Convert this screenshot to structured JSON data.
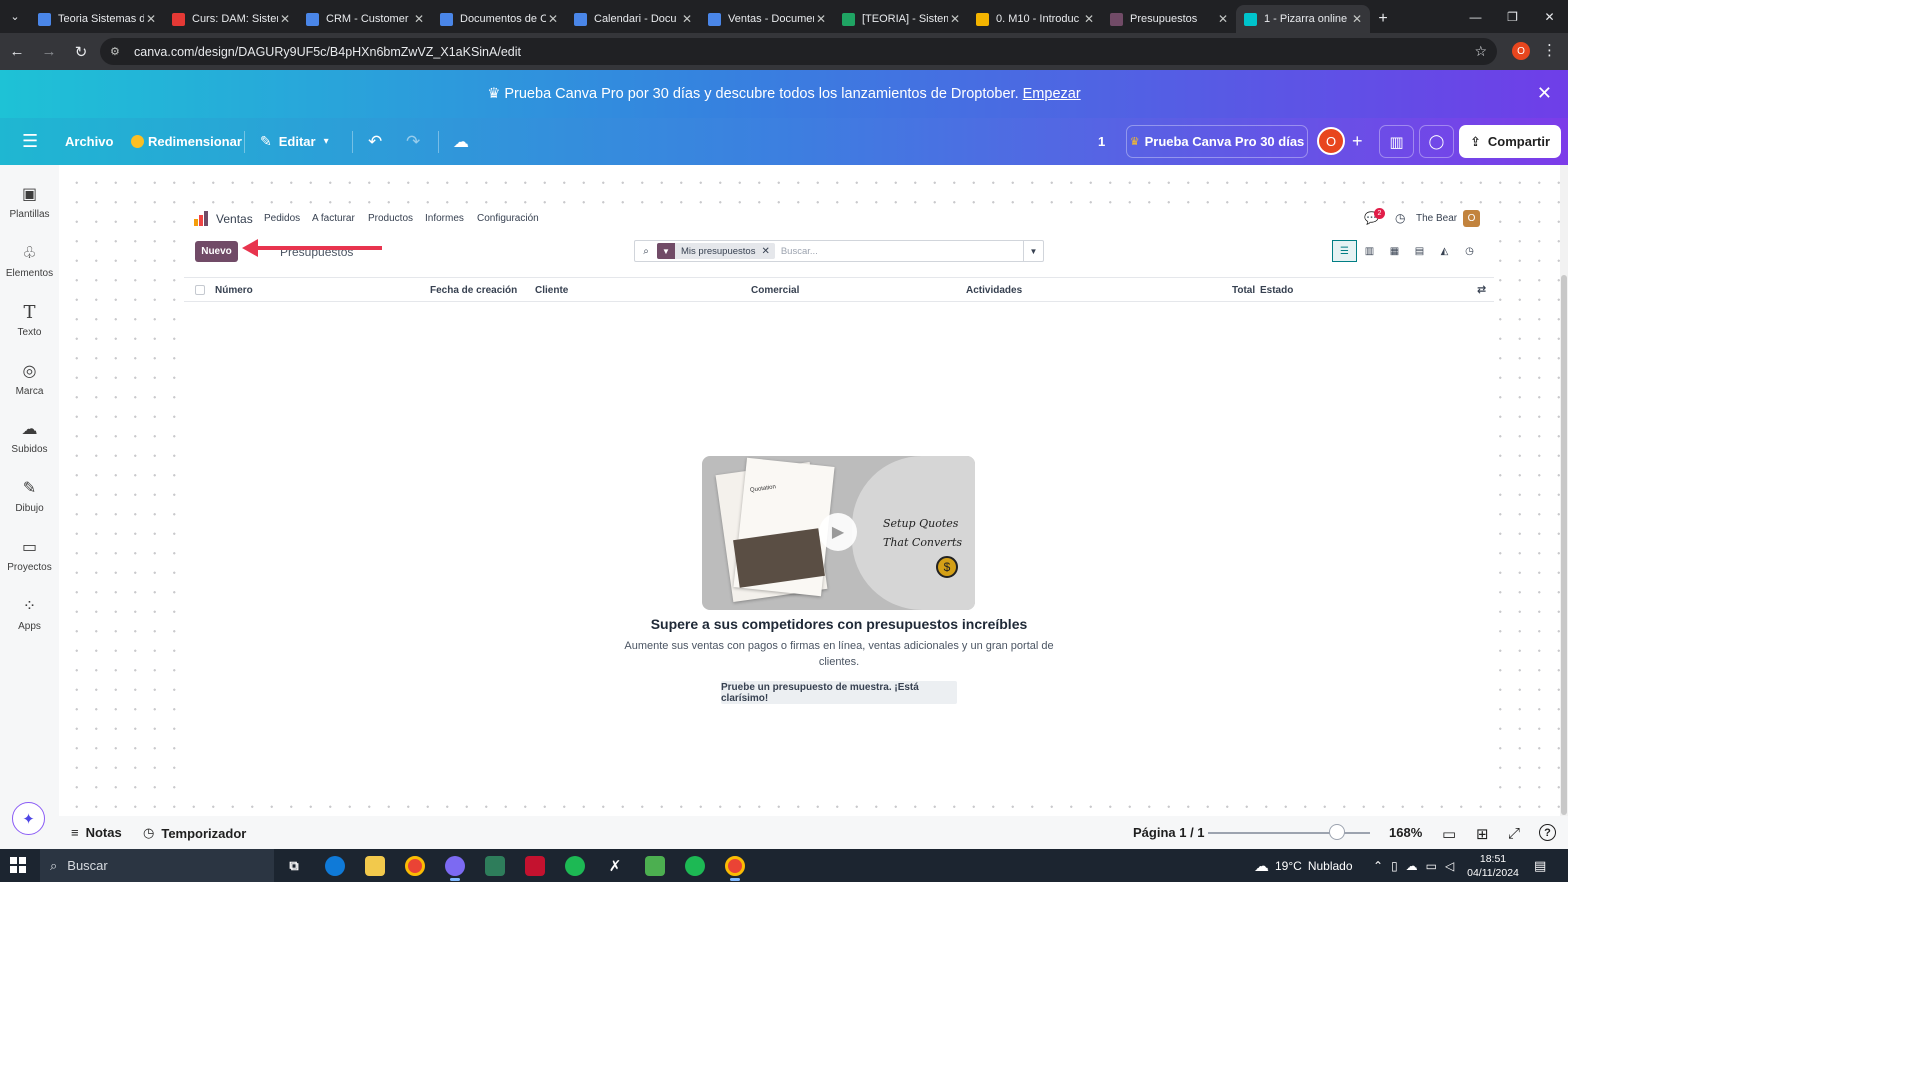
{
  "browser": {
    "tabs": [
      {
        "title": "Teoria Sistemas de",
        "favicon_color": "#4a86e8",
        "active": false
      },
      {
        "title": "Curs: DAM: Sistem",
        "favicon_color": "#e53935",
        "active": false
      },
      {
        "title": "CRM - Customer R",
        "favicon_color": "#4a86e8",
        "active": false
      },
      {
        "title": "Documentos de C",
        "favicon_color": "#4a86e8",
        "active": false
      },
      {
        "title": "Calendari - Docu",
        "favicon_color": "#4a86e8",
        "active": false
      },
      {
        "title": "Ventas - Documer",
        "favicon_color": "#4a86e8",
        "active": false
      },
      {
        "title": "[TEORIA] - Sistem",
        "favicon_color": "#1fa463",
        "active": false
      },
      {
        "title": "0. M10 - Introduc",
        "favicon_color": "#f4b400",
        "active": false
      },
      {
        "title": "Presupuestos",
        "favicon_color": "#714b67",
        "active": false
      },
      {
        "title": "1 - Pizarra online",
        "favicon_color": "#00c4cc",
        "active": true
      }
    ],
    "url": "canva.com/design/DAGURy9UF5c/B4pHXn6bmZwVZ_X1aKSinA/edit",
    "profile_initial": "O"
  },
  "promo": {
    "text": "♛ Prueba Canva Pro por 30 días y descubre todos los lanzamientos de Droptober.",
    "link": "Empezar"
  },
  "header": {
    "archivo": "Archivo",
    "redimensionar": "Redimensionar",
    "editar": "Editar",
    "page_count": "1",
    "trial": "Prueba Canva Pro 30 días",
    "avatar": "O",
    "share": "Compartir"
  },
  "sidebar": {
    "items": [
      {
        "label": "Plantillas",
        "icon": "template-icon"
      },
      {
        "label": "Elementos",
        "icon": "elements-icon"
      },
      {
        "label": "Texto",
        "icon": "text-icon"
      },
      {
        "label": "Marca",
        "icon": "brand-icon"
      },
      {
        "label": "Subidos",
        "icon": "upload-icon"
      },
      {
        "label": "Dibujo",
        "icon": "draw-icon"
      },
      {
        "label": "Proyectos",
        "icon": "folder-icon"
      },
      {
        "label": "Apps",
        "icon": "apps-icon"
      }
    ]
  },
  "odoo": {
    "app": "Ventas",
    "menu": [
      "Pedidos",
      "A facturar",
      "Productos",
      "Informes",
      "Configuración"
    ],
    "chat_count": "2",
    "company": "The Bear",
    "user_initial": "O",
    "new_button": "Nuevo",
    "breadcrumb": "Presupuestos",
    "facet": "Mis presupuestos",
    "search_placeholder": "Buscar...",
    "columns": [
      "Número",
      "Fecha de creación",
      "Cliente",
      "Comercial",
      "Actividades",
      "Total",
      "Estado"
    ],
    "video_title": "Setup Quotes That Converts",
    "video_doc_text": "Quotation",
    "headline": "Supere a sus competidores con presupuestos increíbles",
    "subtext": "Aumente sus ventas con pagos o firmas en línea, ventas adicionales y un gran portal de clientes.",
    "sample_button": "Pruebe un presupuesto de muestra. ¡Está clarísimo!"
  },
  "footer": {
    "notes": "Notas",
    "timer": "Temporizador",
    "page": "Página 1 / 1",
    "zoom": "168%",
    "zoom_slider_fraction": 0.85
  },
  "taskbar": {
    "search": "Buscar",
    "weather": "19°C",
    "weather_desc": "Nublado",
    "time": "18:51",
    "date": "04/11/2024"
  },
  "colors": {
    "odoo_primary": "#714b67",
    "annotation_arrow": "#e8344e",
    "canva_gradient_start": "#1ec2d6",
    "canva_gradient_end": "#7c3ce9"
  }
}
